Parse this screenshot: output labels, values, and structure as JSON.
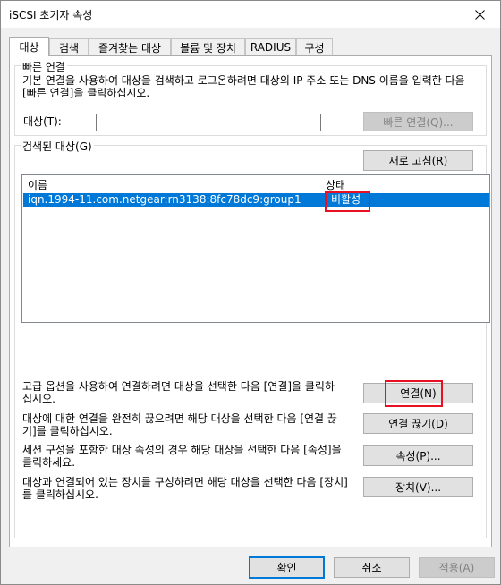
{
  "window": {
    "title": "iSCSI 초기자 속성",
    "close_icon": "close-icon"
  },
  "tabs": [
    {
      "label": "대상",
      "active": true
    },
    {
      "label": "검색"
    },
    {
      "label": "즐겨찾는 대상"
    },
    {
      "label": "볼륨 및 장치"
    },
    {
      "label": "RADIUS"
    },
    {
      "label": "구성"
    }
  ],
  "quick_connect": {
    "legend": "빠른 연결",
    "description": "기본 연결을 사용하여 대상을 검색하고 로그온하려면 대상의 IP 주소 또는 DNS 이름을 입력한 다음 [빠른 연결]을 클릭하십시오.",
    "target_label": "대상(T):",
    "target_value": "",
    "button_label": "빠른 연결(Q)..."
  },
  "discovered": {
    "legend": "검색된 대상(G)",
    "refresh_label": "새로 고침(R)",
    "columns": [
      "이름",
      "상태"
    ],
    "rows": [
      {
        "name": "iqn.1994-11.com.netgear:rn3138:8fc78dc9:group1",
        "status": "비활성"
      }
    ]
  },
  "actions": [
    {
      "text": "고급 옵션을 사용하여 연결하려면 대상을 선택한 다음 [연결]을 클릭하십시오.",
      "button": "연결(N)"
    },
    {
      "text": "대상에 대한 연결을 완전히 끊으려면 해당 대상을 선택한 다음 [연결 끊기]를 클릭하십시오.",
      "button": "연결 끊기(D)"
    },
    {
      "text": "세션 구성을 포함한 대상 속성의 경우 해당 대상을 선택한 다음 [속성]을 클릭하세요.",
      "button": "속성(P)..."
    },
    {
      "text": "대상과 연결되어 있는 장치를 구성하려면 해당 대상을 선택한 다음 [장치]를 클릭하십시오.",
      "button": "장치(V)..."
    }
  ],
  "footer": {
    "ok": "확인",
    "cancel": "취소",
    "apply": "적용(A)"
  },
  "colors": {
    "accent": "#0078d7",
    "highlight": "#e81123"
  }
}
